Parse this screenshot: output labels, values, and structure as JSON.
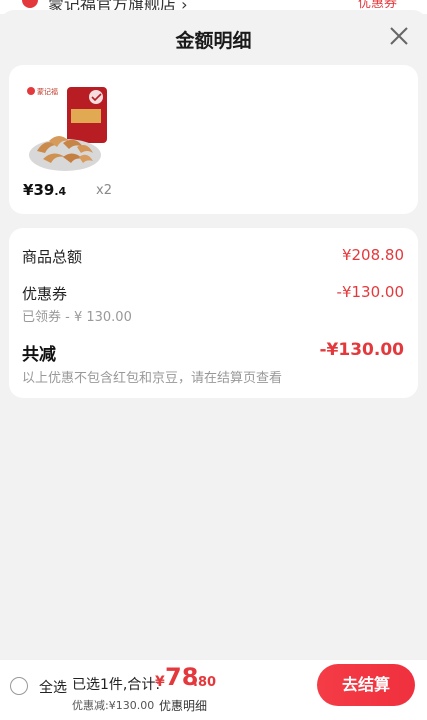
{
  "background_store": {
    "name": "蒙记福官方旗舰店 ›",
    "coupon": "优惠券"
  },
  "sheet": {
    "title": "金额明细",
    "close_icon": "close-icon"
  },
  "product": {
    "brand_mark": "蒙记福",
    "price_currency": "¥",
    "price_int": "39",
    "price_dec": ".4",
    "quantity": "x2"
  },
  "details": {
    "goods_total_label": "商品总额",
    "goods_total_value": "¥208.80",
    "coupon_label": "优惠券",
    "coupon_value": "-¥130.00",
    "coupon_sub": "已领券 - ¥ 130.00",
    "total_reduction_label": "共减",
    "total_reduction_value": "-¥130.00",
    "note": "以上优惠不包含红包和京豆，请在结算页查看"
  },
  "bottom_bar": {
    "select_all": "全选",
    "summary": "已选1件,合计:",
    "total_currency": "¥",
    "total_int": "78",
    "total_dec": ".80",
    "discount": "优惠减:¥130.00",
    "detail_link": "优惠明细",
    "checkout": "去结算"
  },
  "colors": {
    "accent": "#e4393c",
    "background": "#f2f2f2",
    "card": "#ffffff"
  }
}
